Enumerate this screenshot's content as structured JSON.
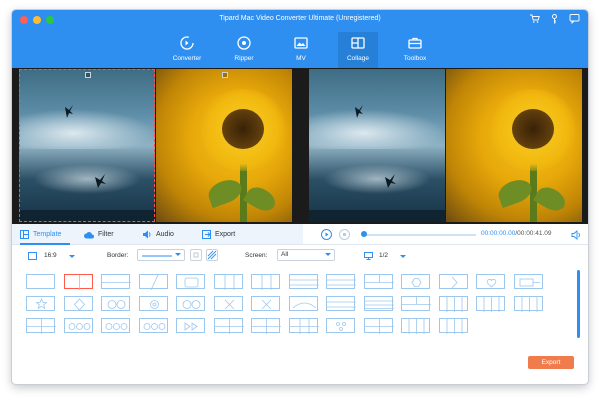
{
  "window": {
    "title": "Tipard Mac Video Converter Ultimate (Unregistered)"
  },
  "top_icons": [
    "cart-icon",
    "key-icon",
    "feedback-icon"
  ],
  "nav": [
    {
      "label": "Converter",
      "icon": "converter-icon"
    },
    {
      "label": "Ripper",
      "icon": "ripper-icon"
    },
    {
      "label": "MV",
      "icon": "mv-icon"
    },
    {
      "label": "Collage",
      "icon": "collage-icon",
      "active": true
    },
    {
      "label": "Toolbox",
      "icon": "toolbox-icon"
    }
  ],
  "tabs": [
    {
      "label": "Template",
      "icon": "template-icon",
      "active": true
    },
    {
      "label": "Filter",
      "icon": "filter-icon"
    },
    {
      "label": "Audio",
      "icon": "audio-icon"
    },
    {
      "label": "Export",
      "icon": "export-icon"
    }
  ],
  "player": {
    "current": "00:00:00.00",
    "separator": "/",
    "total": "00:00:41.09",
    "progress": 0
  },
  "options": {
    "ratio": "16:9",
    "border_label": "Border:",
    "screen_label": "Screen:",
    "screen_value": "All",
    "page": "1/2"
  },
  "export_button": "Export",
  "colors": {
    "accent": "#2f8ff0",
    "export": "#f17c4b",
    "selected": "#ff5a4a"
  }
}
